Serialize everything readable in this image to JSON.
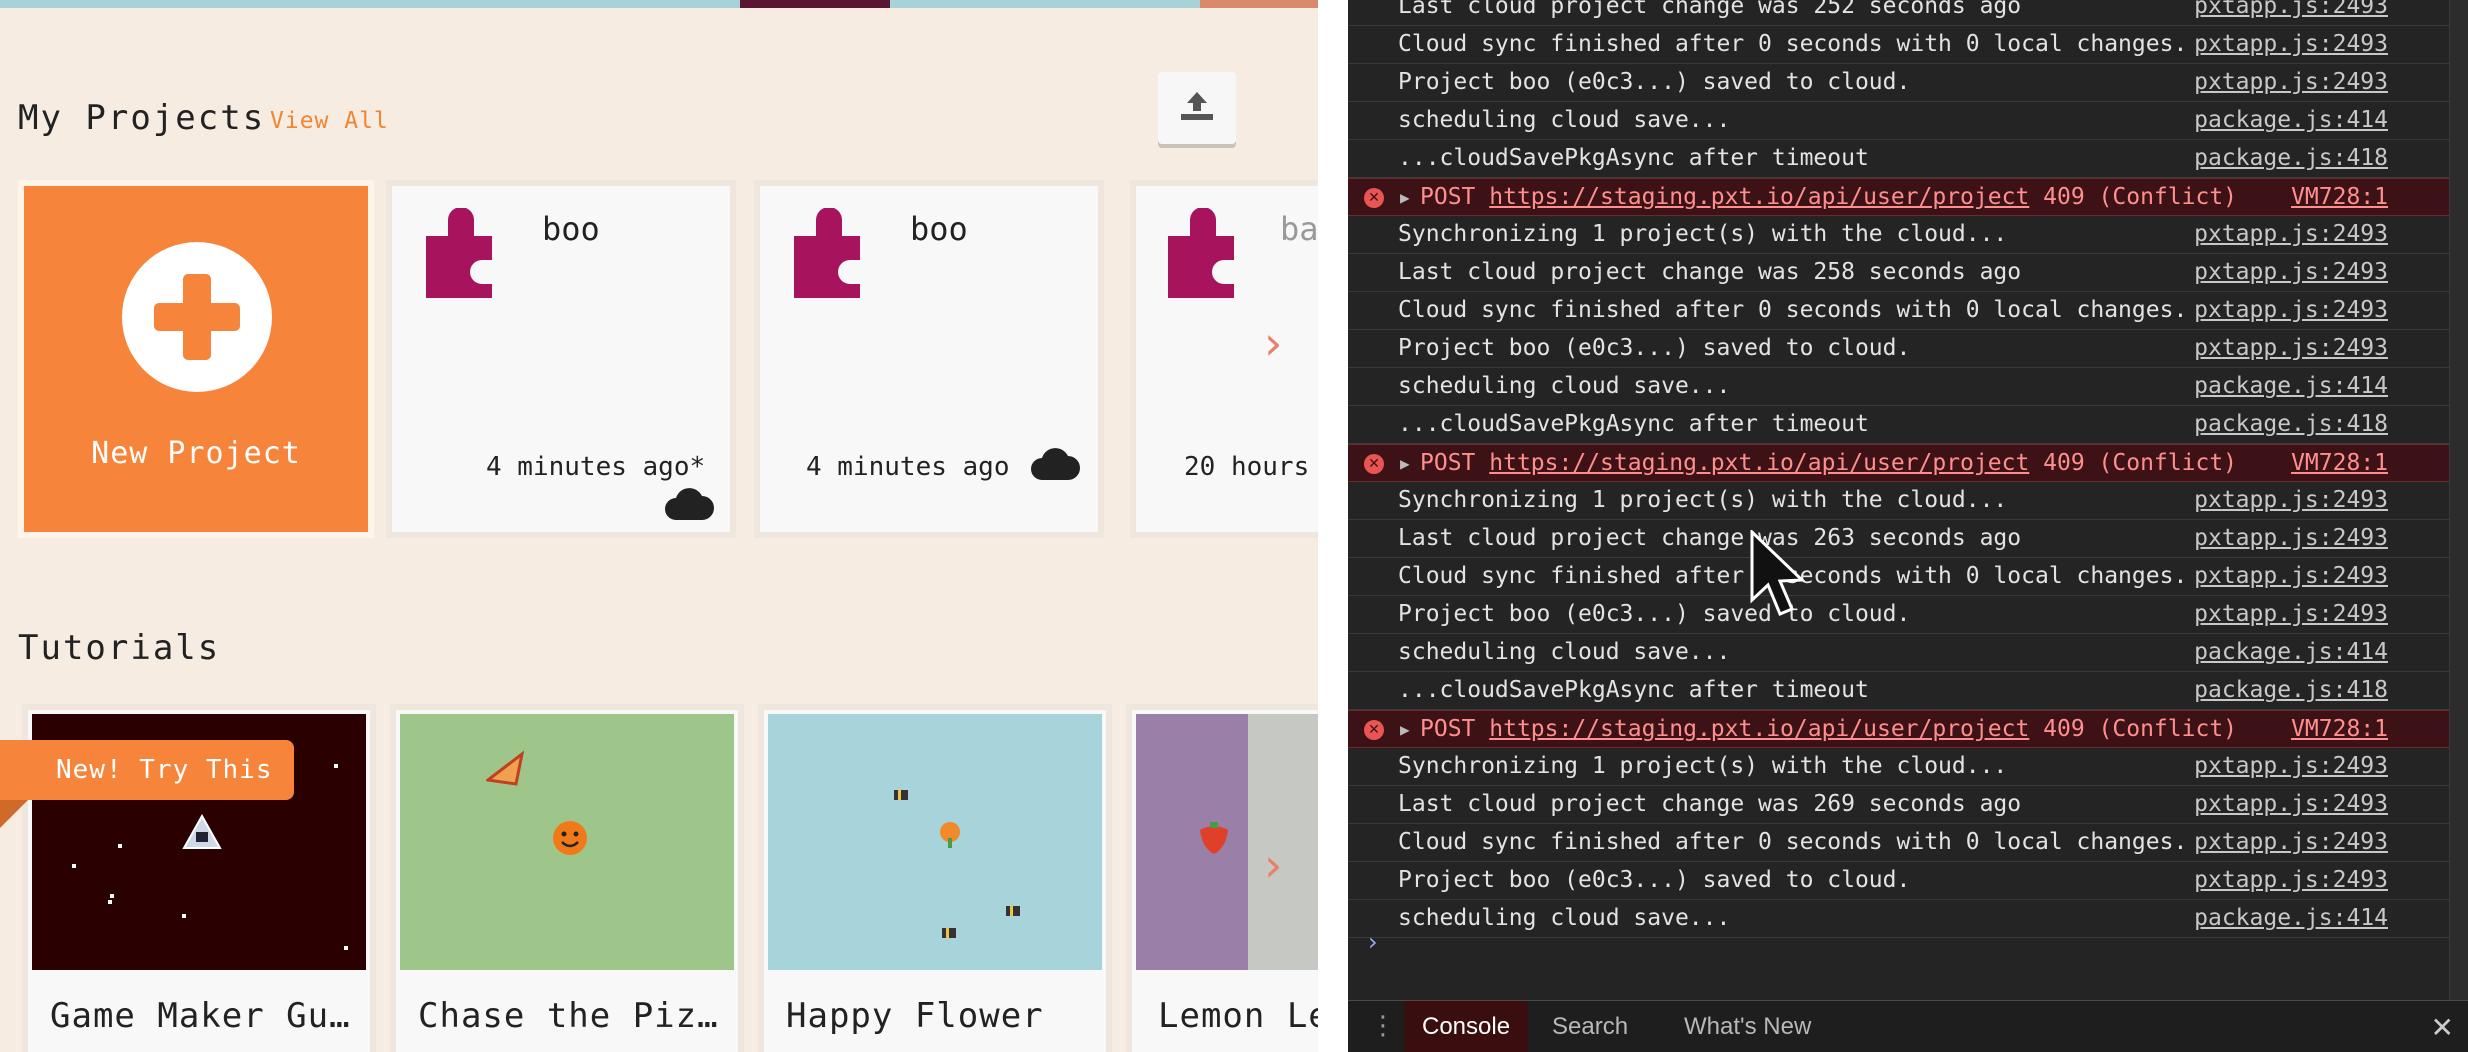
{
  "app": {
    "projects": {
      "title": "My Projects",
      "view_all": "View All",
      "new_project": "New Project",
      "cards": [
        {
          "name": "boo",
          "time": "4 minutes ago*",
          "cloud": "cloud-icon"
        },
        {
          "name": "boo",
          "time": "4 minutes ago",
          "cloud": "cloud-icon"
        },
        {
          "name": "ba",
          "time": "20 hours"
        }
      ]
    },
    "tutorials": {
      "title": "Tutorials",
      "badge": "New! Try This",
      "cards": [
        {
          "name": "Game Maker Gu…"
        },
        {
          "name": "Chase the Piz…"
        },
        {
          "name": "Happy Flower"
        },
        {
          "name": "Lemon Le"
        }
      ]
    }
  },
  "console": {
    "rows": [
      {
        "type": "log",
        "msg": "Last cloud project change was 252 seconds ago",
        "src": "pxtapp.js:2493"
      },
      {
        "type": "log",
        "msg": "Cloud sync finished after 0 seconds with 0 local changes.",
        "src": "pxtapp.js:2493"
      },
      {
        "type": "log",
        "msg": "Project boo (e0c3...) saved to cloud.",
        "src": "pxtapp.js:2493"
      },
      {
        "type": "log",
        "msg": "scheduling cloud save...",
        "src": "package.js:414"
      },
      {
        "type": "log",
        "msg": "...cloudSavePkgAsync after timeout",
        "src": "package.js:418"
      },
      {
        "type": "error",
        "method": "POST",
        "url": "https://staging.pxt.io/api/user/project",
        "status": "409 (Conflict)",
        "src": "VM728:1"
      },
      {
        "type": "log",
        "msg": "Synchronizing 1 project(s) with the cloud...",
        "src": "pxtapp.js:2493"
      },
      {
        "type": "log",
        "msg": "Last cloud project change was 258 seconds ago",
        "src": "pxtapp.js:2493"
      },
      {
        "type": "log",
        "msg": "Cloud sync finished after 0 seconds with 0 local changes.",
        "src": "pxtapp.js:2493"
      },
      {
        "type": "log",
        "msg": "Project boo (e0c3...) saved to cloud.",
        "src": "pxtapp.js:2493"
      },
      {
        "type": "log",
        "msg": "scheduling cloud save...",
        "src": "package.js:414"
      },
      {
        "type": "log",
        "msg": "...cloudSavePkgAsync after timeout",
        "src": "package.js:418"
      },
      {
        "type": "error",
        "method": "POST",
        "url": "https://staging.pxt.io/api/user/project",
        "status": "409 (Conflict)",
        "src": "VM728:1"
      },
      {
        "type": "log",
        "msg": "Synchronizing 1 project(s) with the cloud...",
        "src": "pxtapp.js:2493"
      },
      {
        "type": "log",
        "msg": "Last cloud project change was 263 seconds ago",
        "src": "pxtapp.js:2493"
      },
      {
        "type": "log",
        "msg": "Cloud sync finished after 0 seconds with 0 local changes.",
        "src": "pxtapp.js:2493"
      },
      {
        "type": "log",
        "msg": "Project boo (e0c3...) saved to cloud.",
        "src": "pxtapp.js:2493"
      },
      {
        "type": "log",
        "msg": "scheduling cloud save...",
        "src": "package.js:414"
      },
      {
        "type": "log",
        "msg": "...cloudSavePkgAsync after timeout",
        "src": "package.js:418"
      },
      {
        "type": "error",
        "method": "POST",
        "url": "https://staging.pxt.io/api/user/project",
        "status": "409 (Conflict)",
        "src": "VM728:1"
      },
      {
        "type": "log",
        "msg": "Synchronizing 1 project(s) with the cloud...",
        "src": "pxtapp.js:2493"
      },
      {
        "type": "log",
        "msg": "Last cloud project change was 269 seconds ago",
        "src": "pxtapp.js:2493"
      },
      {
        "type": "log",
        "msg": "Cloud sync finished after 0 seconds with 0 local changes.",
        "src": "pxtapp.js:2493"
      },
      {
        "type": "log",
        "msg": "Project boo (e0c3...) saved to cloud.",
        "src": "pxtapp.js:2493"
      },
      {
        "type": "log",
        "msg": "scheduling cloud save...",
        "src": "package.js:414"
      }
    ],
    "prompt": "›",
    "tabs": [
      "Console",
      "Search",
      "What's New"
    ]
  },
  "colors": {
    "accent": "#f6843a",
    "puzzle": "#a8135e",
    "error_bg": "#3c1216",
    "error_text": "#ff8e8e"
  }
}
